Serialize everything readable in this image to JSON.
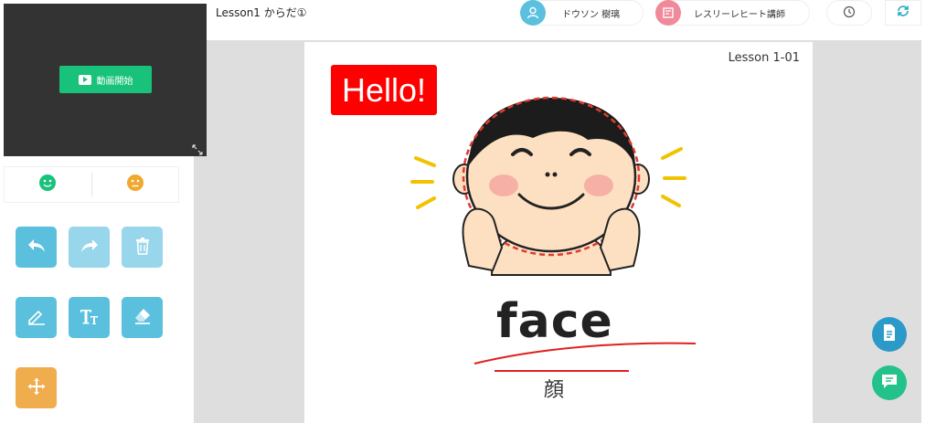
{
  "header": {
    "lesson_title": "Lesson1 からだ①",
    "student_name": "ドウソン 樹璃",
    "teacher_name": "レスリーレヒート講師"
  },
  "video": {
    "start_label": "動画開始"
  },
  "slide": {
    "lesson_number": "Lesson 1-01",
    "greeting": "Hello!",
    "word": "face",
    "translation": "顔"
  },
  "colors": {
    "tool_blue": "#5bc0de",
    "tool_blue_disabled": "#98d6ec",
    "tool_orange": "#f0ad4e",
    "green": "#19c27a",
    "doc_button": "#2c9ac8",
    "chat_button": "#22c28a"
  }
}
